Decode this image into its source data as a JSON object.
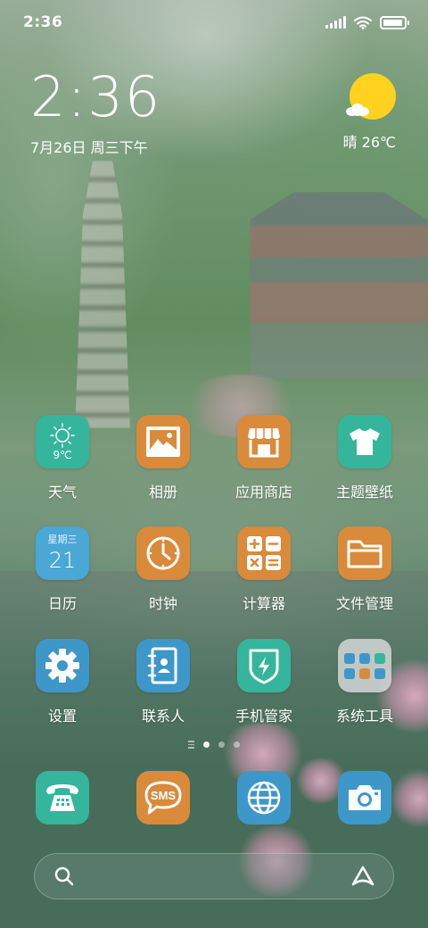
{
  "status_bar": {
    "time": "2:36",
    "battery_level": 0.95
  },
  "clock": {
    "time": "2:36",
    "date": "7月26日 周三下午"
  },
  "weather": {
    "text": "晴 26℃",
    "icon": "sunny-cloud-icon"
  },
  "apps": [
    {
      "label": "天气",
      "icon": "weather-icon",
      "temp": "9℃"
    },
    {
      "label": "相册",
      "icon": "gallery-icon"
    },
    {
      "label": "应用商店",
      "icon": "store-icon"
    },
    {
      "label": "主题壁纸",
      "icon": "tshirt-icon"
    },
    {
      "label": "日历",
      "icon": "calendar-icon",
      "weekday": "星期三",
      "day": "21"
    },
    {
      "label": "时钟",
      "icon": "clock-icon"
    },
    {
      "label": "计算器",
      "icon": "calculator-icon"
    },
    {
      "label": "文件管理",
      "icon": "folder-icon"
    },
    {
      "label": "设置",
      "icon": "gear-icon"
    },
    {
      "label": "联系人",
      "icon": "contacts-icon"
    },
    {
      "label": "手机管家",
      "icon": "shield-icon"
    },
    {
      "label": "系统工具",
      "icon": "folder-tools-icon"
    }
  ],
  "dock": [
    {
      "icon": "phone-icon"
    },
    {
      "icon": "sms-icon",
      "text": "SMS"
    },
    {
      "icon": "browser-icon"
    },
    {
      "icon": "camera-icon"
    }
  ],
  "page_indicator": {
    "pages": 3,
    "active": 1
  },
  "colors": {
    "teal": "#35b59c",
    "orange": "#d98a3a",
    "blue": "#3e97c9",
    "sun": "#ffd21f"
  }
}
